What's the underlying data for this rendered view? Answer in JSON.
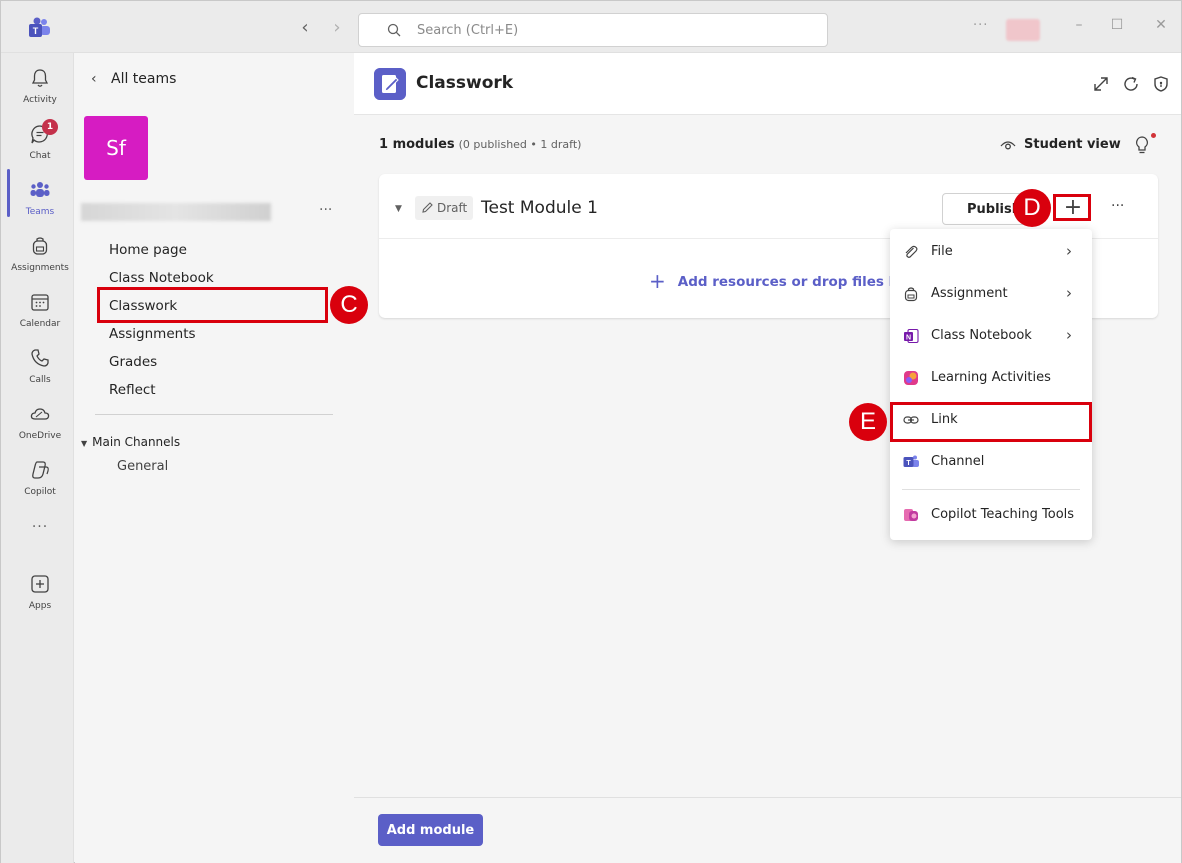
{
  "app": {
    "search_placeholder": "Search (Ctrl+E)",
    "more": "···"
  },
  "rail": {
    "items": [
      {
        "label": "Activity",
        "icon": "bell-icon"
      },
      {
        "label": "Chat",
        "icon": "chat-icon",
        "badge": "1"
      },
      {
        "label": "Teams",
        "icon": "teams-icon",
        "active": true
      },
      {
        "label": "Assignments",
        "icon": "backpack-icon"
      },
      {
        "label": "Calendar",
        "icon": "calendar-icon"
      },
      {
        "label": "Calls",
        "icon": "phone-icon"
      },
      {
        "label": "OneDrive",
        "icon": "cloud-icon"
      },
      {
        "label": "Copilot",
        "icon": "copilot-icon"
      },
      {
        "label": "Apps",
        "icon": "plus-square-icon"
      }
    ],
    "more": "···"
  },
  "team": {
    "back_label": "All teams",
    "avatar_initials": "Sf",
    "more": "···",
    "nav": [
      "Home page",
      "Class Notebook",
      "Classwork",
      "Assignments",
      "Grades",
      "Reflect"
    ],
    "channels_header": "Main Channels",
    "channels": [
      "General"
    ]
  },
  "main": {
    "title": "Classwork",
    "modules_count": "1 modules",
    "modules_sub": "(0 published • 1 draft)",
    "student_view": "Student view",
    "module": {
      "status": "Draft",
      "title": "Test Module 1",
      "publish_label": "Publish",
      "add_resources": "Add resources or drop files here",
      "more": "···"
    },
    "add_module": "Add module"
  },
  "menu": {
    "items": [
      {
        "label": "File",
        "icon": "paperclip-icon",
        "submenu": true
      },
      {
        "label": "Assignment",
        "icon": "backpack-icon",
        "submenu": true
      },
      {
        "label": "Class Notebook",
        "icon": "onenote-icon",
        "submenu": true
      },
      {
        "label": "Learning Activities",
        "icon": "learning-activities-icon",
        "submenu": false
      },
      {
        "label": "Link",
        "icon": "link-icon",
        "submenu": false
      },
      {
        "label": "Channel",
        "icon": "teams-channel-icon",
        "submenu": false
      },
      {
        "label": "Copilot Teaching Tools",
        "icon": "copilot-teaching-icon",
        "submenu": false
      }
    ]
  },
  "annotations": {
    "c": "C",
    "d": "D",
    "e": "E"
  },
  "colors": {
    "accent": "#5b5fc7",
    "highlight": "#d9000d",
    "team_avatar": "#d61cc2",
    "badge": "#c4314b"
  }
}
